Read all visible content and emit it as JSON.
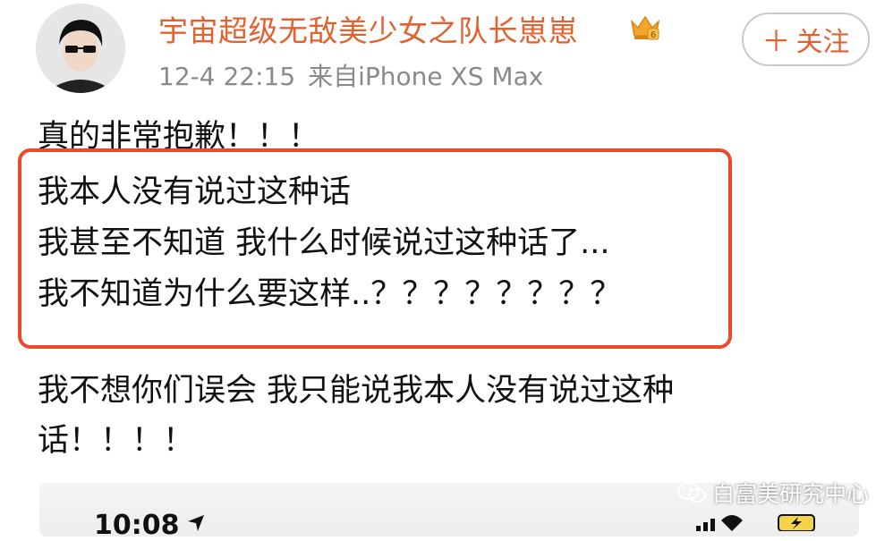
{
  "post": {
    "username": "宇宙超级无敌美少女之队长崽崽",
    "timestamp": "12-4 22:15",
    "source": "来自iPhone XS Max",
    "follow_label": "关注",
    "lines": [
      "真的非常抱歉！！！",
      "我本人没有说过这种话",
      "我甚至不知道 我什么时候说过这种话了...",
      "我不知道为什么要这样..？？？？？？？？",
      "我不想你们误会 我只能说我本人没有说过这种",
      "话！！！！"
    ]
  },
  "screenshot_preview": {
    "time": "10:08"
  },
  "watermark": {
    "text": "白富美研究中心"
  },
  "colors": {
    "username": "#e2622f",
    "highlight_border": "#ea4a29",
    "meta": "#8a8a8a"
  },
  "icons": {
    "crown": "crown-vip-icon",
    "follow": "plus-icon",
    "watermark": "wechat-icon"
  }
}
